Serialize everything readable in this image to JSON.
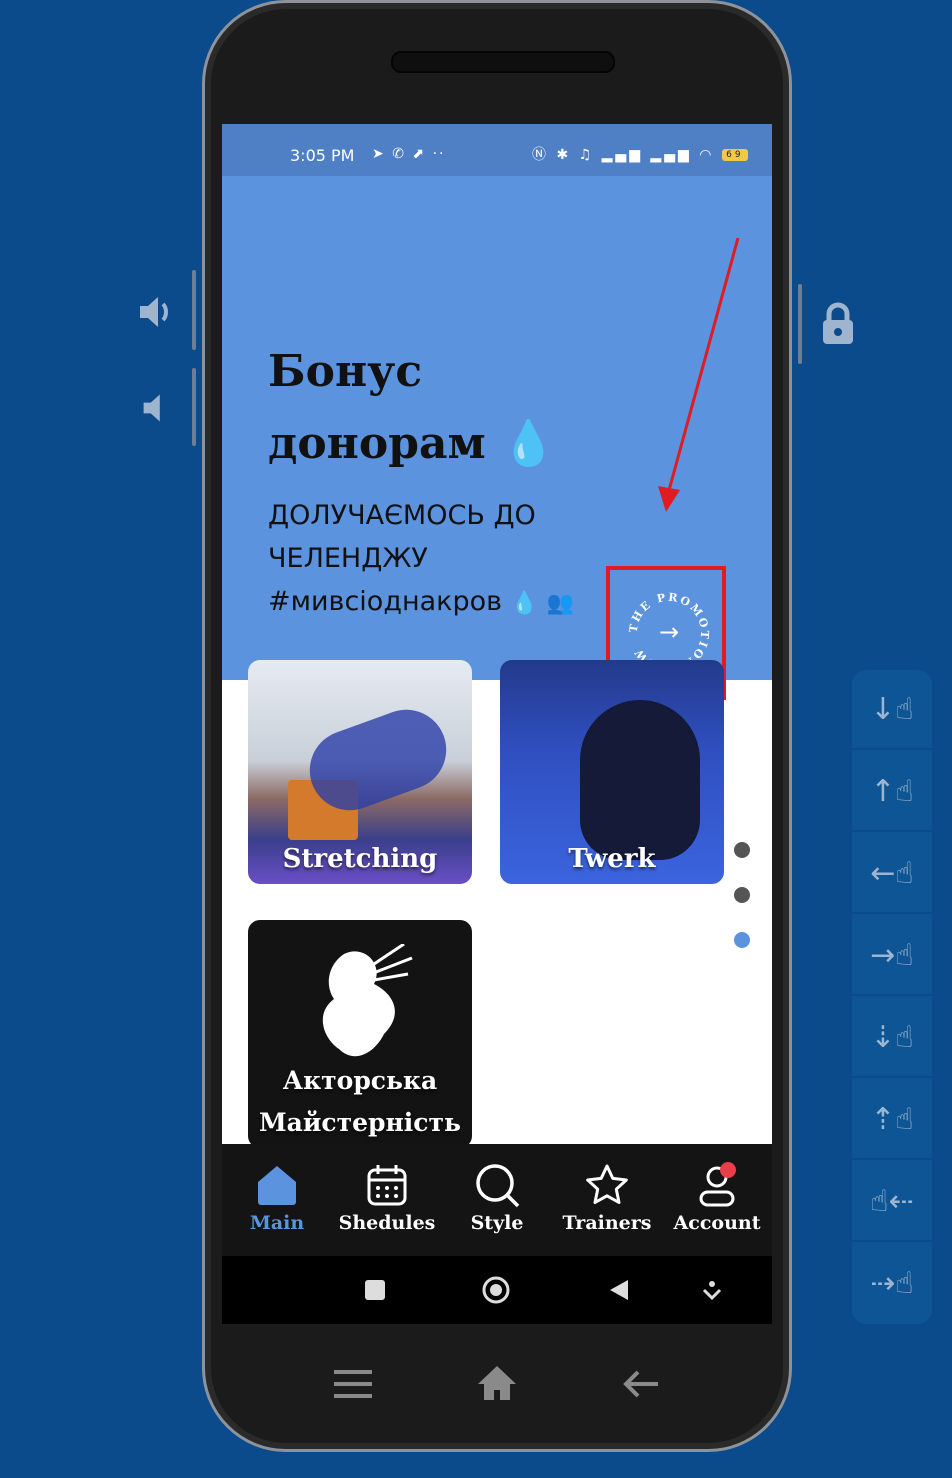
{
  "status_bar": {
    "time": "3:05 PM",
    "left_icons": [
      "telegram-icon",
      "viber-icon",
      "share-icon",
      "more-icon"
    ],
    "right_icons": [
      "nfc-icon",
      "bluetooth-icon",
      "mute-icon",
      "signal-icon",
      "signal-icon",
      "wifi-icon"
    ],
    "battery": "69"
  },
  "banner": {
    "title": "Бонус донорам",
    "subtitle_line1": "ДОЛУЧАЄМОСЬ ДО",
    "subtitle_line2": "ЧЕЛЕНДЖУ",
    "hashtag": "#мивсіоднакров",
    "promo_text": "THE PROMOTION VIEW",
    "highlight_color": "#e01b22"
  },
  "cards": [
    {
      "label": "Stretching"
    },
    {
      "label": "Twerk"
    },
    {
      "label": "Акторська Майстерність"
    }
  ],
  "pager": {
    "count": 3,
    "active_index": 2,
    "active_color": "#5b93df",
    "inactive_color": "#555555"
  },
  "bottom_nav": {
    "items": [
      {
        "label": "Main",
        "icon": "home-icon",
        "active": true
      },
      {
        "label": "Shedules",
        "icon": "calendar-icon",
        "active": false
      },
      {
        "label": "Style",
        "icon": "search-icon",
        "active": false
      },
      {
        "label": "Trainers",
        "icon": "star-icon",
        "active": false
      },
      {
        "label": "Account",
        "icon": "account-icon",
        "active": false,
        "badge": true
      }
    ],
    "active_color": "#5b93df"
  },
  "system_nav": [
    "recents-icon",
    "home-circle-icon",
    "back-icon",
    "collapse-icon"
  ],
  "emulator": {
    "side_controls": [
      "volume-up-icon",
      "volume-down-icon",
      "lock-icon"
    ],
    "gesture_tools": [
      "swipe-down-icon",
      "swipe-up-icon",
      "swipe-left-icon",
      "swipe-right-icon",
      "scroll-down-icon",
      "scroll-up-icon",
      "scroll-left-icon",
      "scroll-right-icon"
    ],
    "hardware_nav": [
      "menu-icon",
      "home-icon",
      "back-arrow-icon"
    ]
  }
}
